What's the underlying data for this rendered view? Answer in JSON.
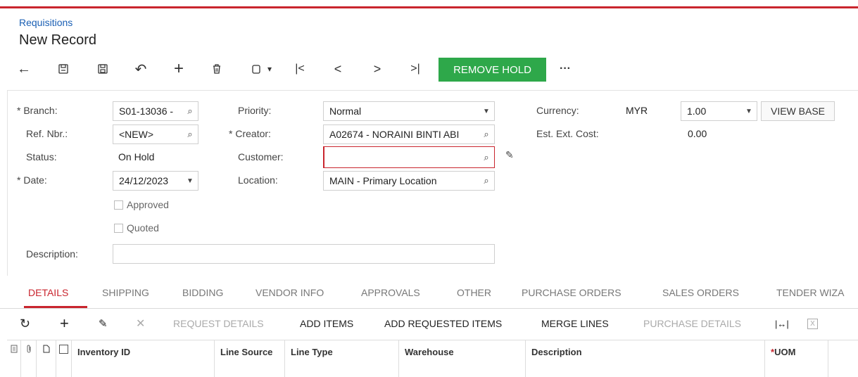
{
  "breadcrumb": "Requisitions",
  "page_title": "New Record",
  "toolbar": {
    "back": "←",
    "save_close": "⎘",
    "save": "🖫",
    "undo": "↶",
    "add": "+",
    "delete": "🗑",
    "copy": "⧉",
    "copy_caret": "▾",
    "first": "|<",
    "prev": "<",
    "next": ">",
    "last": ">|",
    "remove_hold": "REMOVE HOLD",
    "more": "···"
  },
  "form": {
    "branch_label": "Branch:",
    "branch_value": "S01-13036 -",
    "refnbr_label": "Ref. Nbr.:",
    "refnbr_value": "<NEW>",
    "status_label": "Status:",
    "status_value": "On Hold",
    "date_label": "Date:",
    "date_value": "24/12/2023",
    "approved_label": "Approved",
    "quoted_label": "Quoted",
    "description_label": "Description:",
    "description_value": "",
    "priority_label": "Priority:",
    "priority_value": "Normal",
    "creator_label": "Creator:",
    "creator_value": "A02674 - NORAINI BINTI ABI",
    "customer_label": "Customer:",
    "customer_value": "",
    "location_label": "Location:",
    "location_value": "MAIN - Primary Location",
    "currency_label": "Currency:",
    "currency_code": "MYR",
    "currency_rate": "1.00",
    "view_base_label": "VIEW BASE",
    "est_cost_label": "Est. Ext. Cost:",
    "est_cost_value": "0.00",
    "required_mark": "*"
  },
  "tabs": [
    "DETAILS",
    "SHIPPING",
    "BIDDING",
    "VENDOR INFO",
    "APPROVALS",
    "OTHER",
    "PURCHASE ORDERS",
    "SALES ORDERS",
    "TENDER WIZA"
  ],
  "grid_toolbar": {
    "refresh": "↻",
    "add": "+",
    "edit": "✎",
    "delete": "✕",
    "request_details": "REQUEST DETAILS",
    "add_items": "ADD ITEMS",
    "add_requested_items": "ADD REQUESTED ITEMS",
    "merge_lines": "MERGE LINES",
    "purchase_details": "PURCHASE DETAILS",
    "fit_columns": "|↔|",
    "excel": "X"
  },
  "grid_columns": {
    "inventory_id": "Inventory ID",
    "line_source": "Line Source",
    "line_type": "Line Type",
    "warehouse": "Warehouse",
    "description": "Description",
    "uom": "UOM"
  },
  "colors": {
    "accent": "#c9252e",
    "hold_button": "#2ea84a",
    "link": "#1a5fb4"
  }
}
